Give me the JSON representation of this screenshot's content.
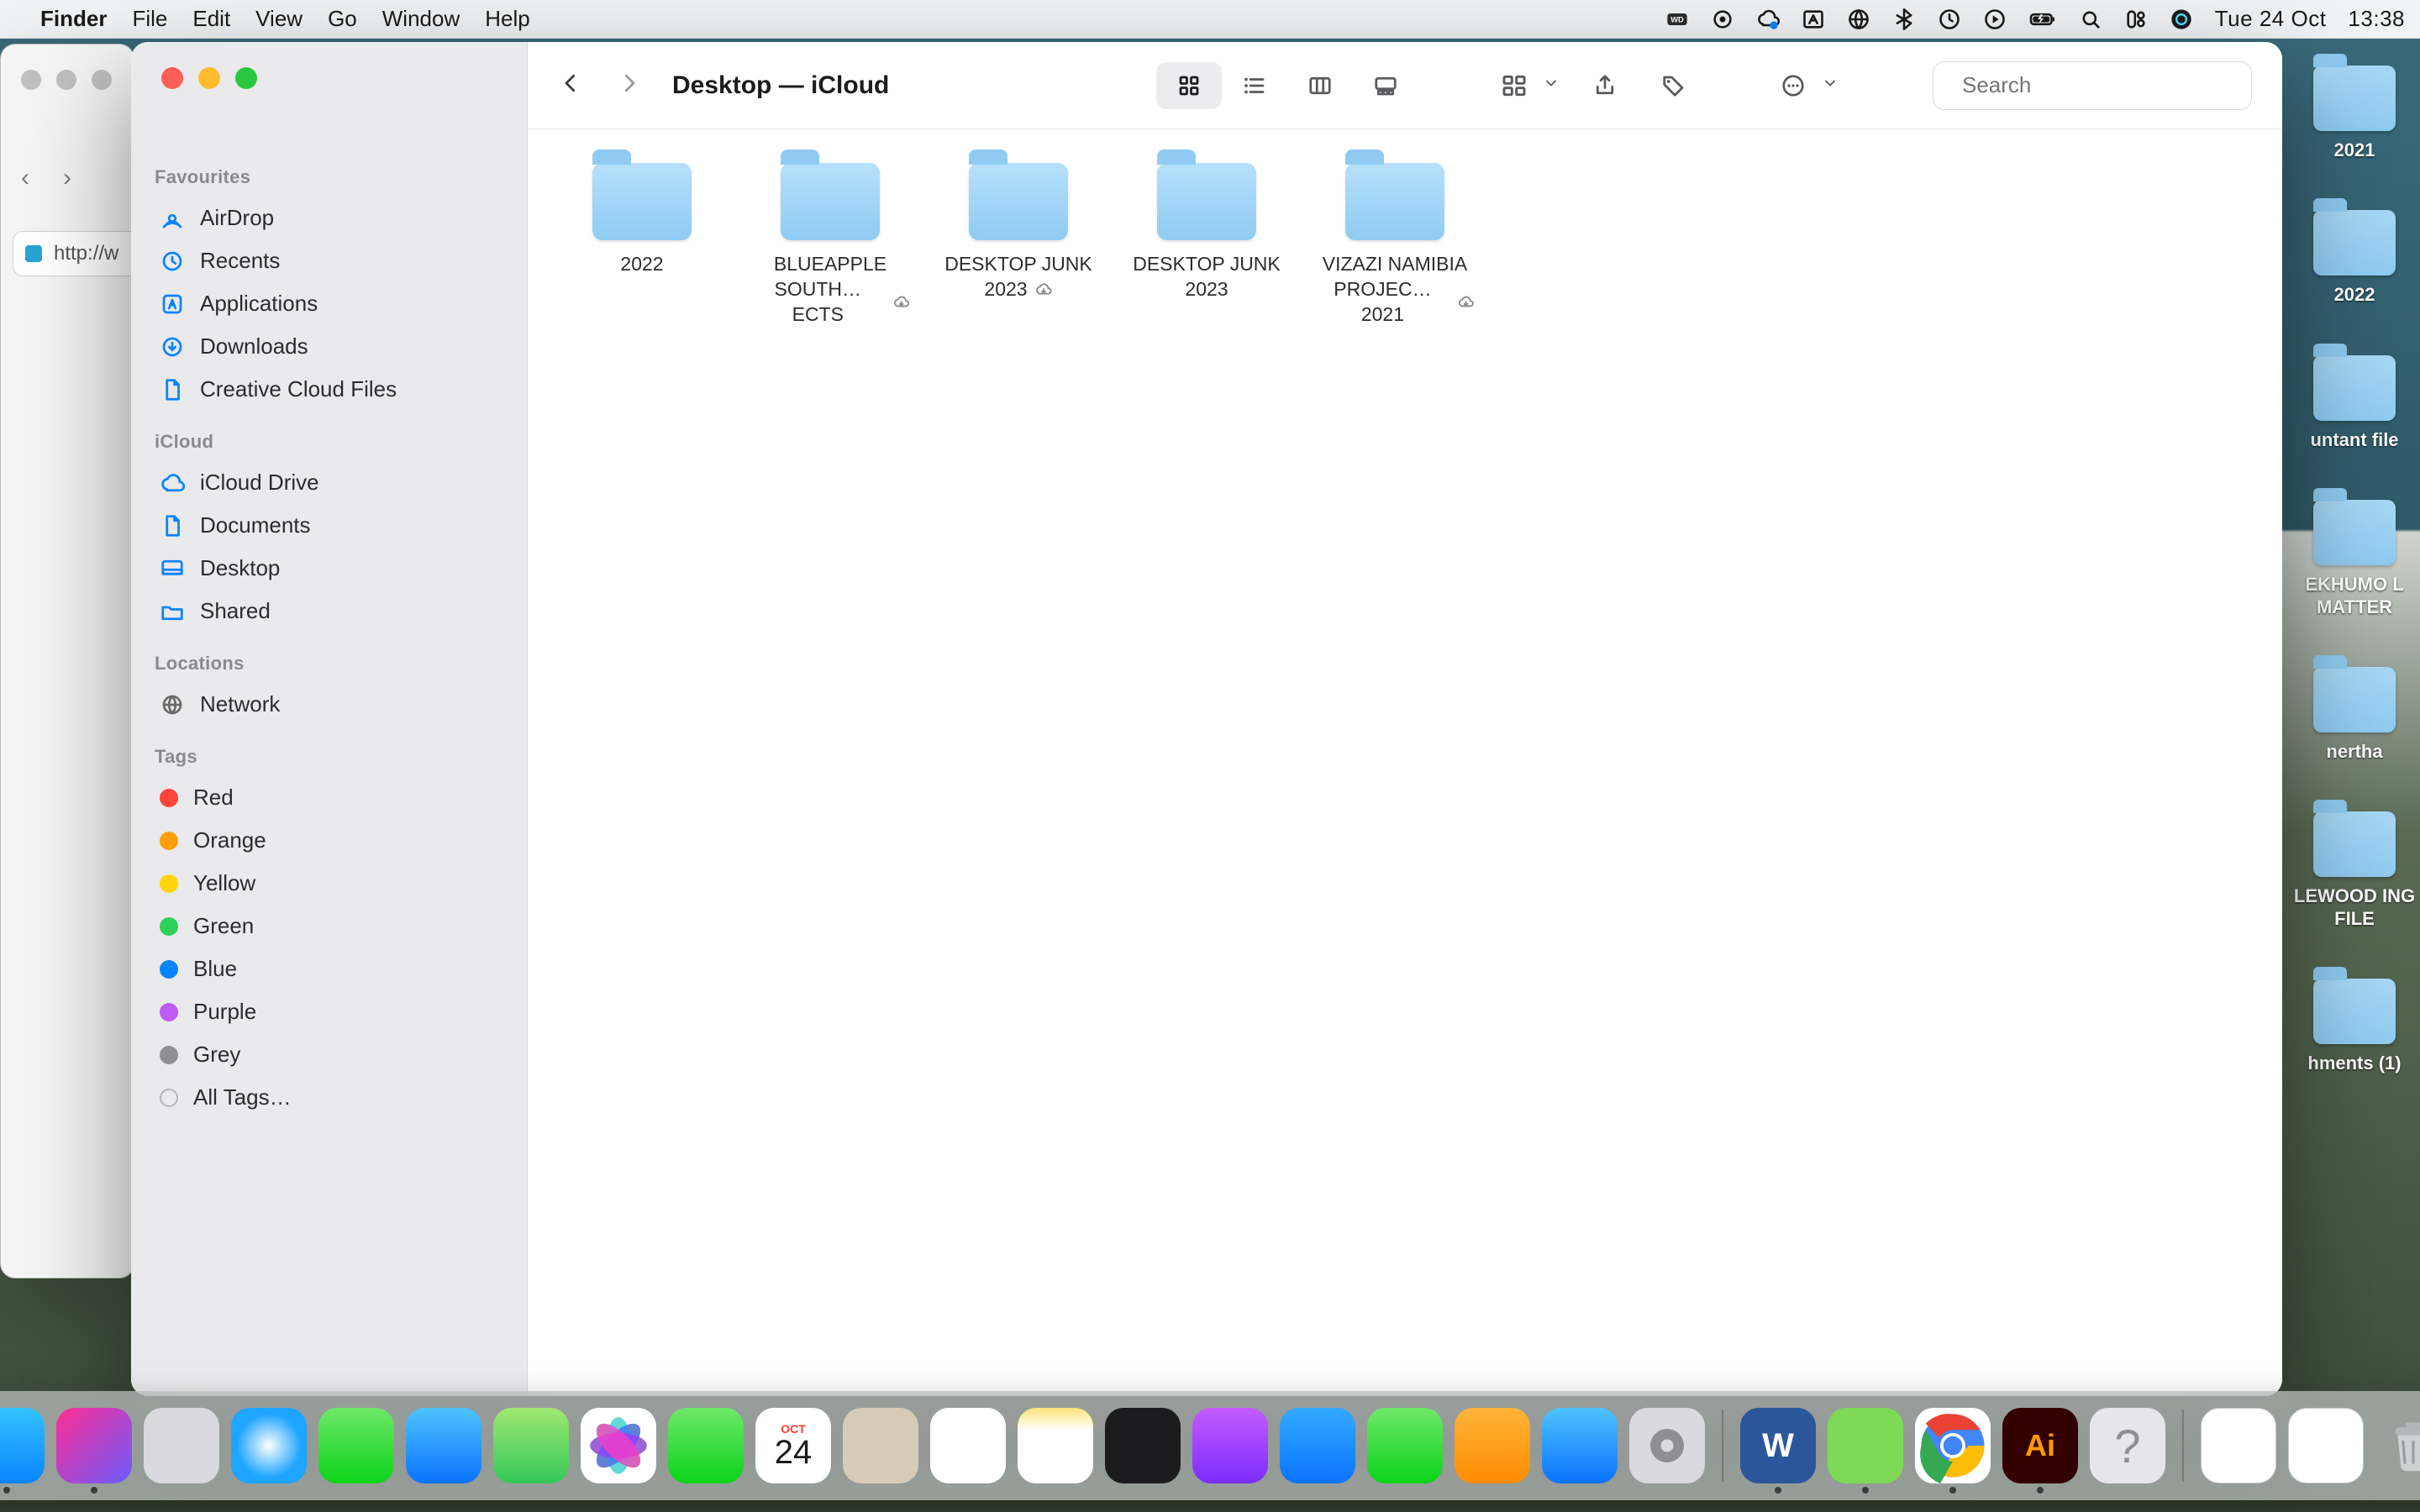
{
  "menubar": {
    "app": "Finder",
    "items": [
      "File",
      "Edit",
      "View",
      "Go",
      "Window",
      "Help"
    ],
    "date": "Tue 24 Oct",
    "time": "13:38"
  },
  "bg_browser": {
    "url_stub": "http://w"
  },
  "desktop_folders": [
    {
      "label": "2021"
    },
    {
      "label": "2022"
    },
    {
      "label": "untant file"
    },
    {
      "label": "EKHUMO L MATTER"
    },
    {
      "label": "nertha"
    },
    {
      "label": "LEWOOD ING FILE"
    },
    {
      "label": "hments (1)"
    }
  ],
  "finder": {
    "title": "Desktop — iCloud",
    "search_placeholder": "Search",
    "sidebar": {
      "favourites_head": "Favourites",
      "favourites": [
        {
          "icon": "airdrop",
          "label": "AirDrop"
        },
        {
          "icon": "clock",
          "label": "Recents"
        },
        {
          "icon": "apps",
          "label": "Applications"
        },
        {
          "icon": "download",
          "label": "Downloads"
        },
        {
          "icon": "doc",
          "label": "Creative Cloud Files"
        }
      ],
      "icloud_head": "iCloud",
      "icloud": [
        {
          "icon": "cloud",
          "label": "iCloud Drive"
        },
        {
          "icon": "doc",
          "label": "Documents"
        },
        {
          "icon": "desktop",
          "label": "Desktop"
        },
        {
          "icon": "shared",
          "label": "Shared"
        }
      ],
      "locations_head": "Locations",
      "locations": [
        {
          "icon": "network",
          "label": "Network"
        }
      ],
      "tags_head": "Tags",
      "tags": [
        {
          "color": "red",
          "label": "Red"
        },
        {
          "color": "orange",
          "label": "Orange"
        },
        {
          "color": "yellow",
          "label": "Yellow"
        },
        {
          "color": "green",
          "label": "Green"
        },
        {
          "color": "blue",
          "label": "Blue"
        },
        {
          "color": "purple",
          "label": "Purple"
        },
        {
          "color": "grey",
          "label": "Grey"
        }
      ],
      "all_tags": "All Tags…"
    },
    "folders": [
      {
        "name_l1": "2022",
        "name_l2": "",
        "cloud": false
      },
      {
        "name_l1": "BLUEAPPLE",
        "name_l2": "SOUTH…ECTS",
        "cloud": true
      },
      {
        "name_l1": "DESKTOP JUNK",
        "name_l2": "2023",
        "cloud": true
      },
      {
        "name_l1": "DESKTOP JUNK",
        "name_l2": "2023",
        "cloud": false
      },
      {
        "name_l1": "VIZAZI NAMIBIA",
        "name_l2": "PROJEC…2021",
        "cloud": true
      }
    ]
  },
  "dock": {
    "apps": [
      {
        "name": "finder",
        "bg": "linear-gradient(180deg,#33c2ff,#0a84ff)",
        "running": true
      },
      {
        "name": "shortcuts",
        "bg": "linear-gradient(135deg,#ff2d92,#6a5cff)",
        "running": true
      },
      {
        "name": "launchpad",
        "bg": "#d9d9de",
        "running": false
      },
      {
        "name": "safari",
        "bg": "radial-gradient(circle at 50% 50%,#fff,#1ea5ff 60%)",
        "running": false
      },
      {
        "name": "messages",
        "bg": "linear-gradient(180deg,#6fe86b,#0bd318)",
        "running": false
      },
      {
        "name": "mail",
        "bg": "linear-gradient(180deg,#4fc3ff,#0a73ff)",
        "running": false
      },
      {
        "name": "maps",
        "bg": "linear-gradient(180deg,#9fe870,#34c759)",
        "running": false
      },
      {
        "name": "photos",
        "bg": "#fff",
        "running": false
      },
      {
        "name": "facetime",
        "bg": "linear-gradient(180deg,#6fe86b,#0bd318)",
        "running": false
      },
      {
        "name": "calendar",
        "bg": "#fff",
        "running": false,
        "text": "24",
        "top": "OCT"
      },
      {
        "name": "contacts",
        "bg": "#d6cbb7",
        "running": false
      },
      {
        "name": "reminders",
        "bg": "#fff",
        "running": false
      },
      {
        "name": "notes",
        "bg": "linear-gradient(180deg,#ffe27a,#fff 30%)",
        "running": false
      },
      {
        "name": "tv",
        "bg": "#1c1c1e",
        "running": false
      },
      {
        "name": "podcasts",
        "bg": "linear-gradient(180deg,#c35cff,#7a2cff)",
        "running": false
      },
      {
        "name": "keynote",
        "bg": "linear-gradient(180deg,#34aaff,#0a73ff)",
        "running": false
      },
      {
        "name": "numbers",
        "bg": "linear-gradient(180deg,#6fe86b,#0bd318)",
        "running": false
      },
      {
        "name": "pages",
        "bg": "linear-gradient(180deg,#ffb43a,#ff8c00)",
        "running": false
      },
      {
        "name": "appstore",
        "bg": "linear-gradient(180deg,#4fc3ff,#0a73ff)",
        "running": false
      },
      {
        "name": "settings",
        "bg": "#d9d9de",
        "running": false
      }
    ],
    "apps_right": [
      {
        "name": "word",
        "bg": "#2b579a",
        "running": true
      },
      {
        "name": "utorrent",
        "bg": "#7ed957",
        "running": true
      },
      {
        "name": "chrome",
        "bg": "#fff",
        "running": true
      },
      {
        "name": "illustrator",
        "bg": "#330000",
        "running": true
      },
      {
        "name": "help",
        "bg": "#e5e5ea",
        "running": false
      }
    ],
    "docs": [
      {
        "name": "doc-a",
        "bg": "#fff"
      },
      {
        "name": "doc-b",
        "bg": "#fff"
      }
    ],
    "calendar_month": "OCT",
    "calendar_day": "24"
  }
}
